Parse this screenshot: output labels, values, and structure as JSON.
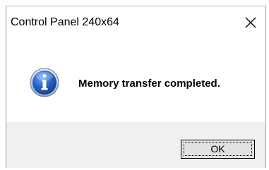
{
  "dialog": {
    "title": "Control Panel 240x64",
    "message": "Memory transfer completed.",
    "ok_label": "OK"
  },
  "icons": {
    "info": "info-icon",
    "close": "close-icon"
  },
  "colors": {
    "info_icon": "#2a5fc4",
    "footer_bg": "#f0f0f0",
    "button_bg": "#e1e1e1"
  }
}
